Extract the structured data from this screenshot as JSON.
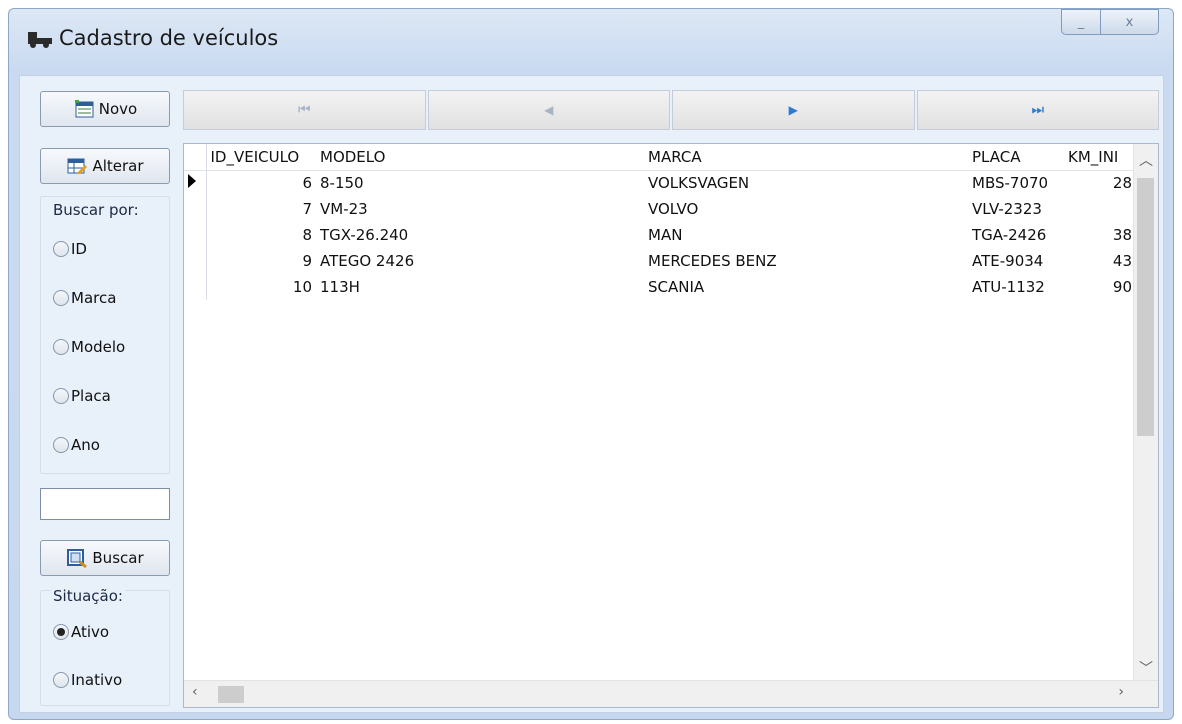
{
  "window": {
    "title": "Cadastro de veículos",
    "min_glyph": "_",
    "close_glyph": "x"
  },
  "buttons": {
    "novo": "Novo",
    "alterar": "Alterar",
    "buscar": "Buscar"
  },
  "search_by": {
    "label": "Buscar por:",
    "options": [
      "ID",
      "Marca",
      "Modelo",
      "Placa",
      "Ano"
    ],
    "selected": null
  },
  "search_input": {
    "value": ""
  },
  "status": {
    "label": "Situação:",
    "options": [
      "Ativo",
      "Inativo"
    ],
    "selected": "Ativo"
  },
  "navigator": {
    "first": "⏮",
    "prior": "◀",
    "next": "▶",
    "last": "⏭"
  },
  "grid": {
    "columns": [
      "ID_VEICULO",
      "MODELO",
      "MARCA",
      "PLACA",
      "KM_INI"
    ],
    "rows": [
      {
        "id": "6",
        "modelo": "8-150",
        "marca": "VOLKSVAGEN",
        "placa": "MBS-7070",
        "km": "28"
      },
      {
        "id": "7",
        "modelo": "VM-23",
        "marca": "VOLVO",
        "placa": "VLV-2323",
        "km": ""
      },
      {
        "id": "8",
        "modelo": "TGX-26.240",
        "marca": "MAN",
        "placa": "TGA-2426",
        "km": "38"
      },
      {
        "id": "9",
        "modelo": "ATEGO 2426",
        "marca": "MERCEDES BENZ",
        "placa": "ATE-9034",
        "km": "43"
      },
      {
        "id": "10",
        "modelo": "113H",
        "marca": "SCANIA",
        "placa": "ATU-1132",
        "km": "90"
      }
    ]
  },
  "colors": {
    "window_bg": "#c9daf0",
    "client_bg": "#e8f0fa",
    "nav_next": "#2a7ad6"
  }
}
